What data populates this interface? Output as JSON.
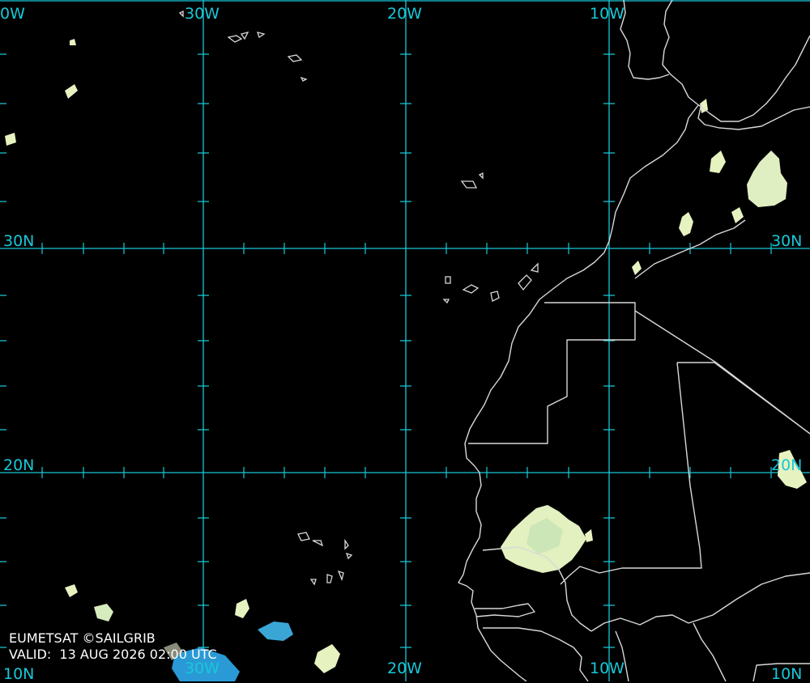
{
  "map": {
    "labels": {
      "lon_top": [
        "0W",
        "30W",
        "20W",
        "10W"
      ],
      "lon_bottom": [
        "30W",
        "20W",
        "10W"
      ],
      "lat_left": [
        "30N",
        "20N",
        "10N"
      ],
      "lat_right": [
        "30N",
        "20N",
        "10N"
      ]
    },
    "credit": "EUMETSAT ©SAILGRIB",
    "valid": "VALID:  13 AUG 2026 02:00 UTC",
    "colors": {
      "background": "#000000",
      "graticule": "#18c8d8",
      "coastline": "#d8d8d8",
      "cloud_light": "#e6f2c0",
      "cloud_blue": "#2a9ad6"
    }
  }
}
